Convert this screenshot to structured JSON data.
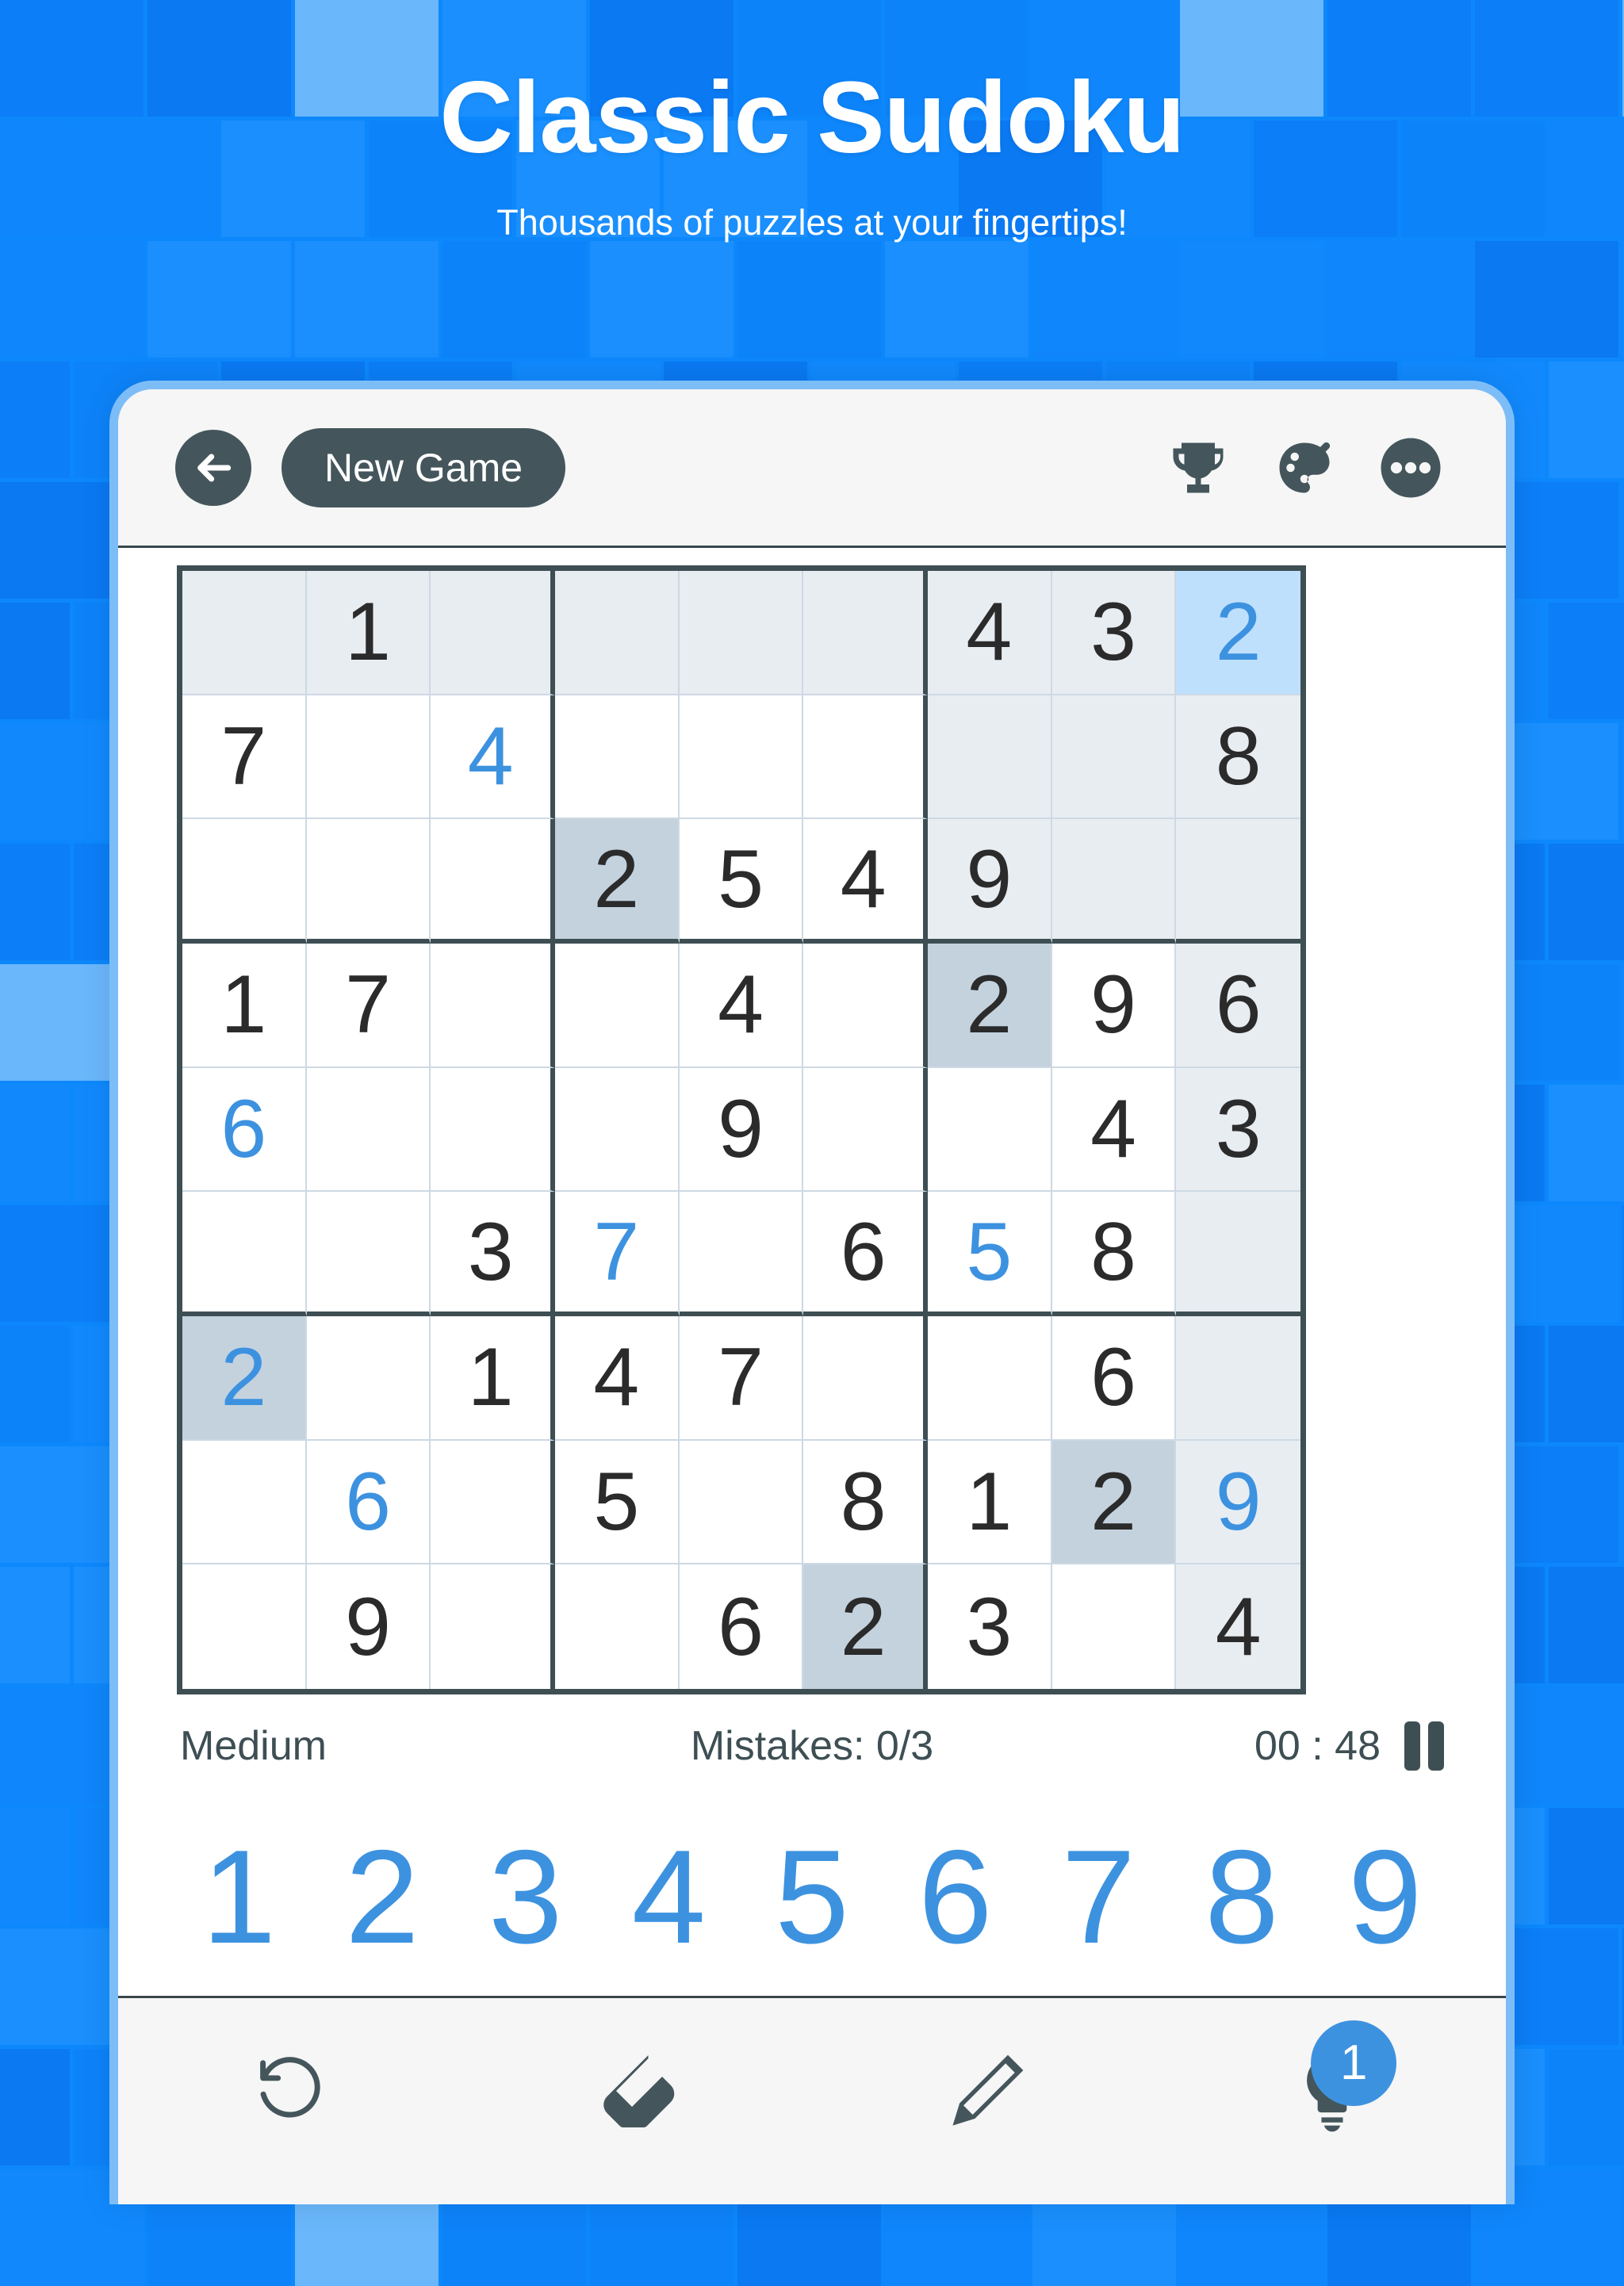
{
  "header": {
    "title": "Classic Sudoku",
    "subtitle": "Thousands of puzzles at your fingertips!"
  },
  "toolbar": {
    "back_icon": "back-arrow-icon",
    "new_game_label": "New Game",
    "trophy_icon": "trophy-icon",
    "palette_icon": "palette-icon",
    "more_icon": "more-options-icon"
  },
  "status": {
    "difficulty": "Medium",
    "mistakes": "Mistakes: 0/3",
    "timer": "00 : 48",
    "pause_icon": "pause-icon"
  },
  "numpad": {
    "keys": [
      "1",
      "2",
      "3",
      "4",
      "5",
      "6",
      "7",
      "8",
      "9"
    ]
  },
  "bottom_tools": {
    "undo_icon": "undo-icon",
    "eraser_icon": "eraser-icon",
    "pencil_icon": "pencil-icon",
    "hint_icon": "lightbulb-hint-icon",
    "hint_count": "1"
  },
  "colors": {
    "page_background": "#0d88fc",
    "card_border": "#7dbdf7",
    "accent_blue": "#3d92e0",
    "dark_slate": "#44565b",
    "grid_line_bold": "#3e4f54",
    "grid_line_thin": "#cdd9e3",
    "cell_peer_highlight": "#e8edf2",
    "cell_samenumber_highlight": "#c4d2de",
    "cell_selected": "#bfe0fd"
  },
  "board": {
    "selected_cell": {
      "row": 1,
      "col": 9,
      "value": "2"
    },
    "highlighted_number": "2",
    "rows": [
      [
        {
          "v": "",
          "s": "given",
          "h": "peer"
        },
        {
          "v": "1",
          "s": "given",
          "h": "peer"
        },
        {
          "v": "",
          "s": "given",
          "h": "peer"
        },
        {
          "v": "",
          "s": "given",
          "h": "peer"
        },
        {
          "v": "",
          "s": "given",
          "h": "peer"
        },
        {
          "v": "",
          "s": "given",
          "h": "peer"
        },
        {
          "v": "4",
          "s": "given",
          "h": "peer"
        },
        {
          "v": "3",
          "s": "given",
          "h": "peer"
        },
        {
          "v": "2",
          "s": "user",
          "h": "sel"
        }
      ],
      [
        {
          "v": "7",
          "s": "given",
          "h": "none"
        },
        {
          "v": "",
          "s": "given",
          "h": "none"
        },
        {
          "v": "4",
          "s": "user",
          "h": "none"
        },
        {
          "v": "",
          "s": "given",
          "h": "none"
        },
        {
          "v": "",
          "s": "given",
          "h": "none"
        },
        {
          "v": "",
          "s": "given",
          "h": "none"
        },
        {
          "v": "",
          "s": "given",
          "h": "peer"
        },
        {
          "v": "",
          "s": "given",
          "h": "peer"
        },
        {
          "v": "8",
          "s": "given",
          "h": "peer"
        }
      ],
      [
        {
          "v": "",
          "s": "given",
          "h": "none"
        },
        {
          "v": "",
          "s": "given",
          "h": "none"
        },
        {
          "v": "",
          "s": "given",
          "h": "none"
        },
        {
          "v": "2",
          "s": "given",
          "h": "samenum"
        },
        {
          "v": "5",
          "s": "given",
          "h": "none"
        },
        {
          "v": "4",
          "s": "given",
          "h": "none"
        },
        {
          "v": "9",
          "s": "given",
          "h": "peer"
        },
        {
          "v": "",
          "s": "given",
          "h": "peer"
        },
        {
          "v": "",
          "s": "given",
          "h": "peer"
        }
      ],
      [
        {
          "v": "1",
          "s": "given",
          "h": "none"
        },
        {
          "v": "7",
          "s": "given",
          "h": "none"
        },
        {
          "v": "",
          "s": "given",
          "h": "none"
        },
        {
          "v": "",
          "s": "given",
          "h": "none"
        },
        {
          "v": "4",
          "s": "given",
          "h": "none"
        },
        {
          "v": "",
          "s": "given",
          "h": "none"
        },
        {
          "v": "2",
          "s": "given",
          "h": "samenum"
        },
        {
          "v": "9",
          "s": "given",
          "h": "none"
        },
        {
          "v": "6",
          "s": "given",
          "h": "peer"
        }
      ],
      [
        {
          "v": "6",
          "s": "user",
          "h": "none"
        },
        {
          "v": "",
          "s": "given",
          "h": "none"
        },
        {
          "v": "",
          "s": "given",
          "h": "none"
        },
        {
          "v": "",
          "s": "given",
          "h": "none"
        },
        {
          "v": "9",
          "s": "given",
          "h": "none"
        },
        {
          "v": "",
          "s": "given",
          "h": "none"
        },
        {
          "v": "",
          "s": "given",
          "h": "none"
        },
        {
          "v": "4",
          "s": "given",
          "h": "none"
        },
        {
          "v": "3",
          "s": "given",
          "h": "peer"
        }
      ],
      [
        {
          "v": "",
          "s": "given",
          "h": "none"
        },
        {
          "v": "",
          "s": "given",
          "h": "none"
        },
        {
          "v": "3",
          "s": "given",
          "h": "none"
        },
        {
          "v": "7",
          "s": "user",
          "h": "none"
        },
        {
          "v": "",
          "s": "given",
          "h": "none"
        },
        {
          "v": "6",
          "s": "given",
          "h": "none"
        },
        {
          "v": "5",
          "s": "user",
          "h": "none"
        },
        {
          "v": "8",
          "s": "given",
          "h": "none"
        },
        {
          "v": "",
          "s": "given",
          "h": "peer"
        }
      ],
      [
        {
          "v": "2",
          "s": "user",
          "h": "samenum"
        },
        {
          "v": "",
          "s": "given",
          "h": "none"
        },
        {
          "v": "1",
          "s": "given",
          "h": "none"
        },
        {
          "v": "4",
          "s": "given",
          "h": "none"
        },
        {
          "v": "7",
          "s": "given",
          "h": "none"
        },
        {
          "v": "",
          "s": "given",
          "h": "none"
        },
        {
          "v": "",
          "s": "given",
          "h": "none"
        },
        {
          "v": "6",
          "s": "given",
          "h": "none"
        },
        {
          "v": "",
          "s": "given",
          "h": "peer"
        }
      ],
      [
        {
          "v": "",
          "s": "given",
          "h": "none"
        },
        {
          "v": "6",
          "s": "user",
          "h": "none"
        },
        {
          "v": "",
          "s": "given",
          "h": "none"
        },
        {
          "v": "5",
          "s": "given",
          "h": "none"
        },
        {
          "v": "",
          "s": "given",
          "h": "none"
        },
        {
          "v": "8",
          "s": "given",
          "h": "none"
        },
        {
          "v": "1",
          "s": "given",
          "h": "none"
        },
        {
          "v": "2",
          "s": "given",
          "h": "samenum"
        },
        {
          "v": "9",
          "s": "user",
          "h": "peer"
        }
      ],
      [
        {
          "v": "",
          "s": "given",
          "h": "none"
        },
        {
          "v": "9",
          "s": "given",
          "h": "none"
        },
        {
          "v": "",
          "s": "given",
          "h": "none"
        },
        {
          "v": "",
          "s": "given",
          "h": "none"
        },
        {
          "v": "6",
          "s": "given",
          "h": "none"
        },
        {
          "v": "2",
          "s": "given",
          "h": "samenum"
        },
        {
          "v": "3",
          "s": "given",
          "h": "none"
        },
        {
          "v": "",
          "s": "given",
          "h": "none"
        },
        {
          "v": "4",
          "s": "given",
          "h": "peer"
        }
      ]
    ]
  }
}
